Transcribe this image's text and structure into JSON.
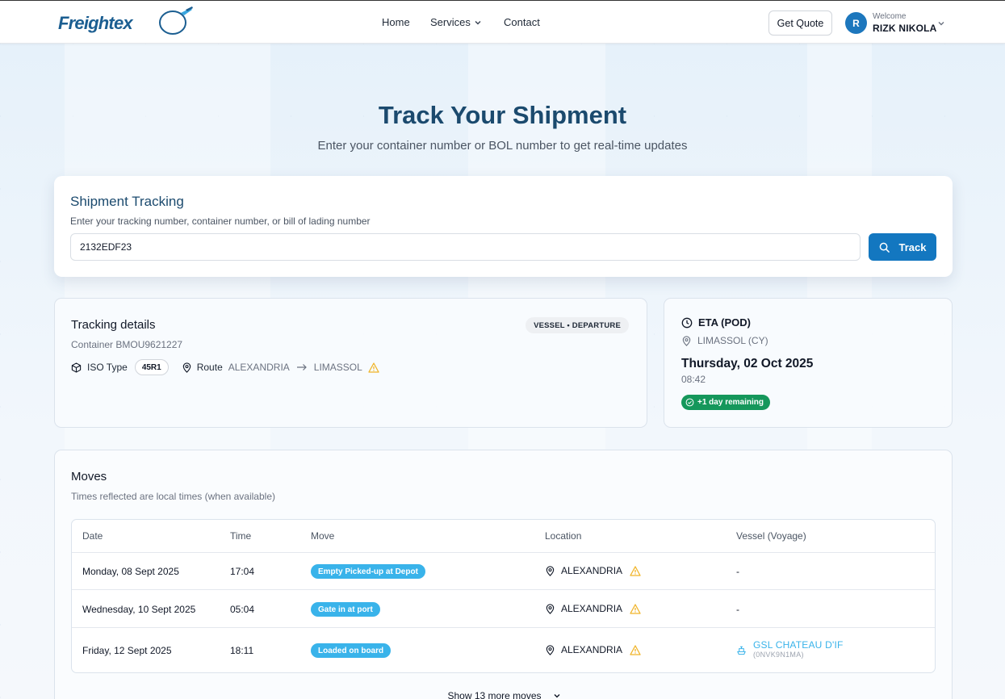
{
  "header": {
    "logo_text": "Freightex",
    "nav": {
      "home": "Home",
      "services": "Services",
      "contact": "Contact"
    },
    "get_quote": "Get Quote",
    "avatar_initial": "R",
    "welcome": "Welcome",
    "username": "RIZK NIKOLA"
  },
  "hero": {
    "title": "Track Your Shipment",
    "subtitle": "Enter your container number or BOL number to get real-time updates"
  },
  "tracking": {
    "title": "Shipment Tracking",
    "description": "Enter your tracking number, container number, or bill of lading number",
    "input_value": "2132EDF23",
    "button_label": "Track"
  },
  "details": {
    "title": "Tracking details",
    "badge": "VESSEL • DEPARTURE",
    "container": "Container BMOU9621227",
    "iso_label": "ISO Type",
    "iso_value": "45R1",
    "route_label": "Route",
    "route_from": "ALEXANDRIA",
    "route_to": "LIMASSOL"
  },
  "eta": {
    "title": "ETA (POD)",
    "location": "LIMASSOL (CY)",
    "date": "Thursday, 02 Oct 2025",
    "time": "08:42",
    "remaining": "+1 day remaining"
  },
  "moves": {
    "title": "Moves",
    "note": "Times reflected are local times (when available)",
    "columns": [
      "Date",
      "Time",
      "Move",
      "Location",
      "Vessel (Voyage)"
    ],
    "rows": [
      {
        "date": "Monday, 08 Sept 2025",
        "time": "17:04",
        "move": "Empty Picked-up at Depot",
        "location": "ALEXANDRIA",
        "vessel": "-"
      },
      {
        "date": "Wednesday, 10 Sept 2025",
        "time": "05:04",
        "move": "Gate in at port",
        "location": "ALEXANDRIA",
        "vessel": "-"
      },
      {
        "date": "Friday, 12 Sept 2025",
        "time": "18:11",
        "move": "Loaded on board",
        "location": "ALEXANDRIA",
        "vessel": "GSL CHATEAU D'IF",
        "voyage": "(0NVK9N1MA)"
      }
    ],
    "show_more": "Show 13 more moves"
  },
  "colors": {
    "brand": "#1377c0",
    "title": "#1b4a6e",
    "pill_blue": "#39b3ea",
    "pill_green": "#15975b",
    "warning": "#f0b429"
  }
}
